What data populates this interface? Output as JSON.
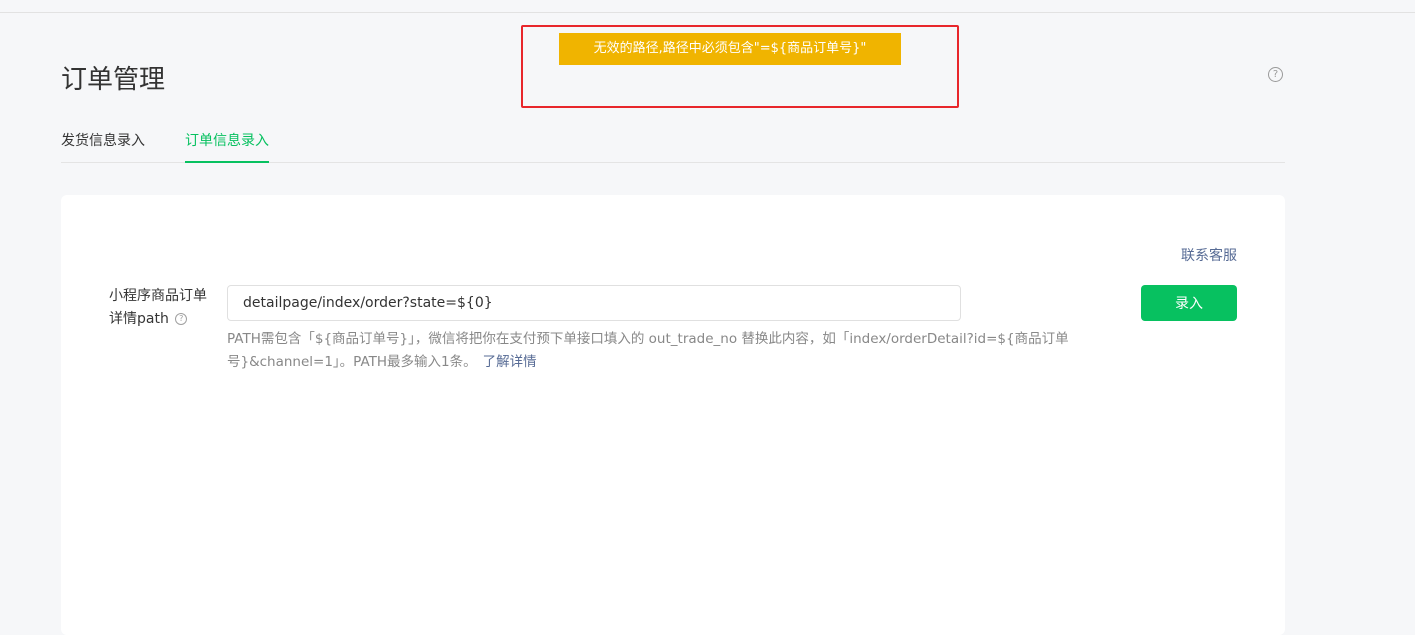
{
  "header": {
    "title": "订单管理",
    "help_icon": "question-circle-icon"
  },
  "tabs": [
    {
      "label": "发货信息录入",
      "active": false
    },
    {
      "label": "订单信息录入",
      "active": true
    }
  ],
  "panel": {
    "service_link": "联系客服",
    "form": {
      "label": "小程序商品订单详情path",
      "label_icon": "question-circle-icon",
      "input_value": "detailpage/index/order?state=${0}",
      "hint_text": "PATH需包含「${商品订单号}」，微信将把你在支付预下单接口填入的 out_trade_no 替换此内容，如「index/orderDetail?id=${商品订单号}&channel=1」。PATH最多输入1条。",
      "hint_link": "了解详情",
      "submit_label": "录入"
    }
  },
  "toast": {
    "message": "无效的路径,路径中必须包含\"=${商品订单号}\""
  },
  "colors": {
    "accent": "#07c160",
    "toast": "#f0b400",
    "link": "#576b95",
    "highlight": "#e8262b"
  }
}
